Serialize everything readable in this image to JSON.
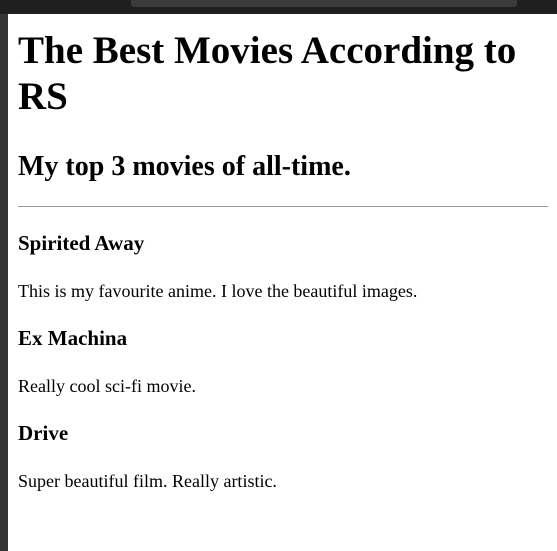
{
  "page": {
    "title": "The Best Movies According to RS",
    "subtitle": "My top 3 movies of all-time."
  },
  "movies": [
    {
      "title": "Spirited Away",
      "description": "This is my favourite anime. I love the beautiful images."
    },
    {
      "title": "Ex Machina",
      "description": "Really cool sci-fi movie."
    },
    {
      "title": "Drive",
      "description": "Super beautiful film. Really artistic."
    }
  ],
  "colors": {
    "window_frame": "#343434",
    "top_bar": "#1f1f1f",
    "divider": "#9a9a9a"
  }
}
